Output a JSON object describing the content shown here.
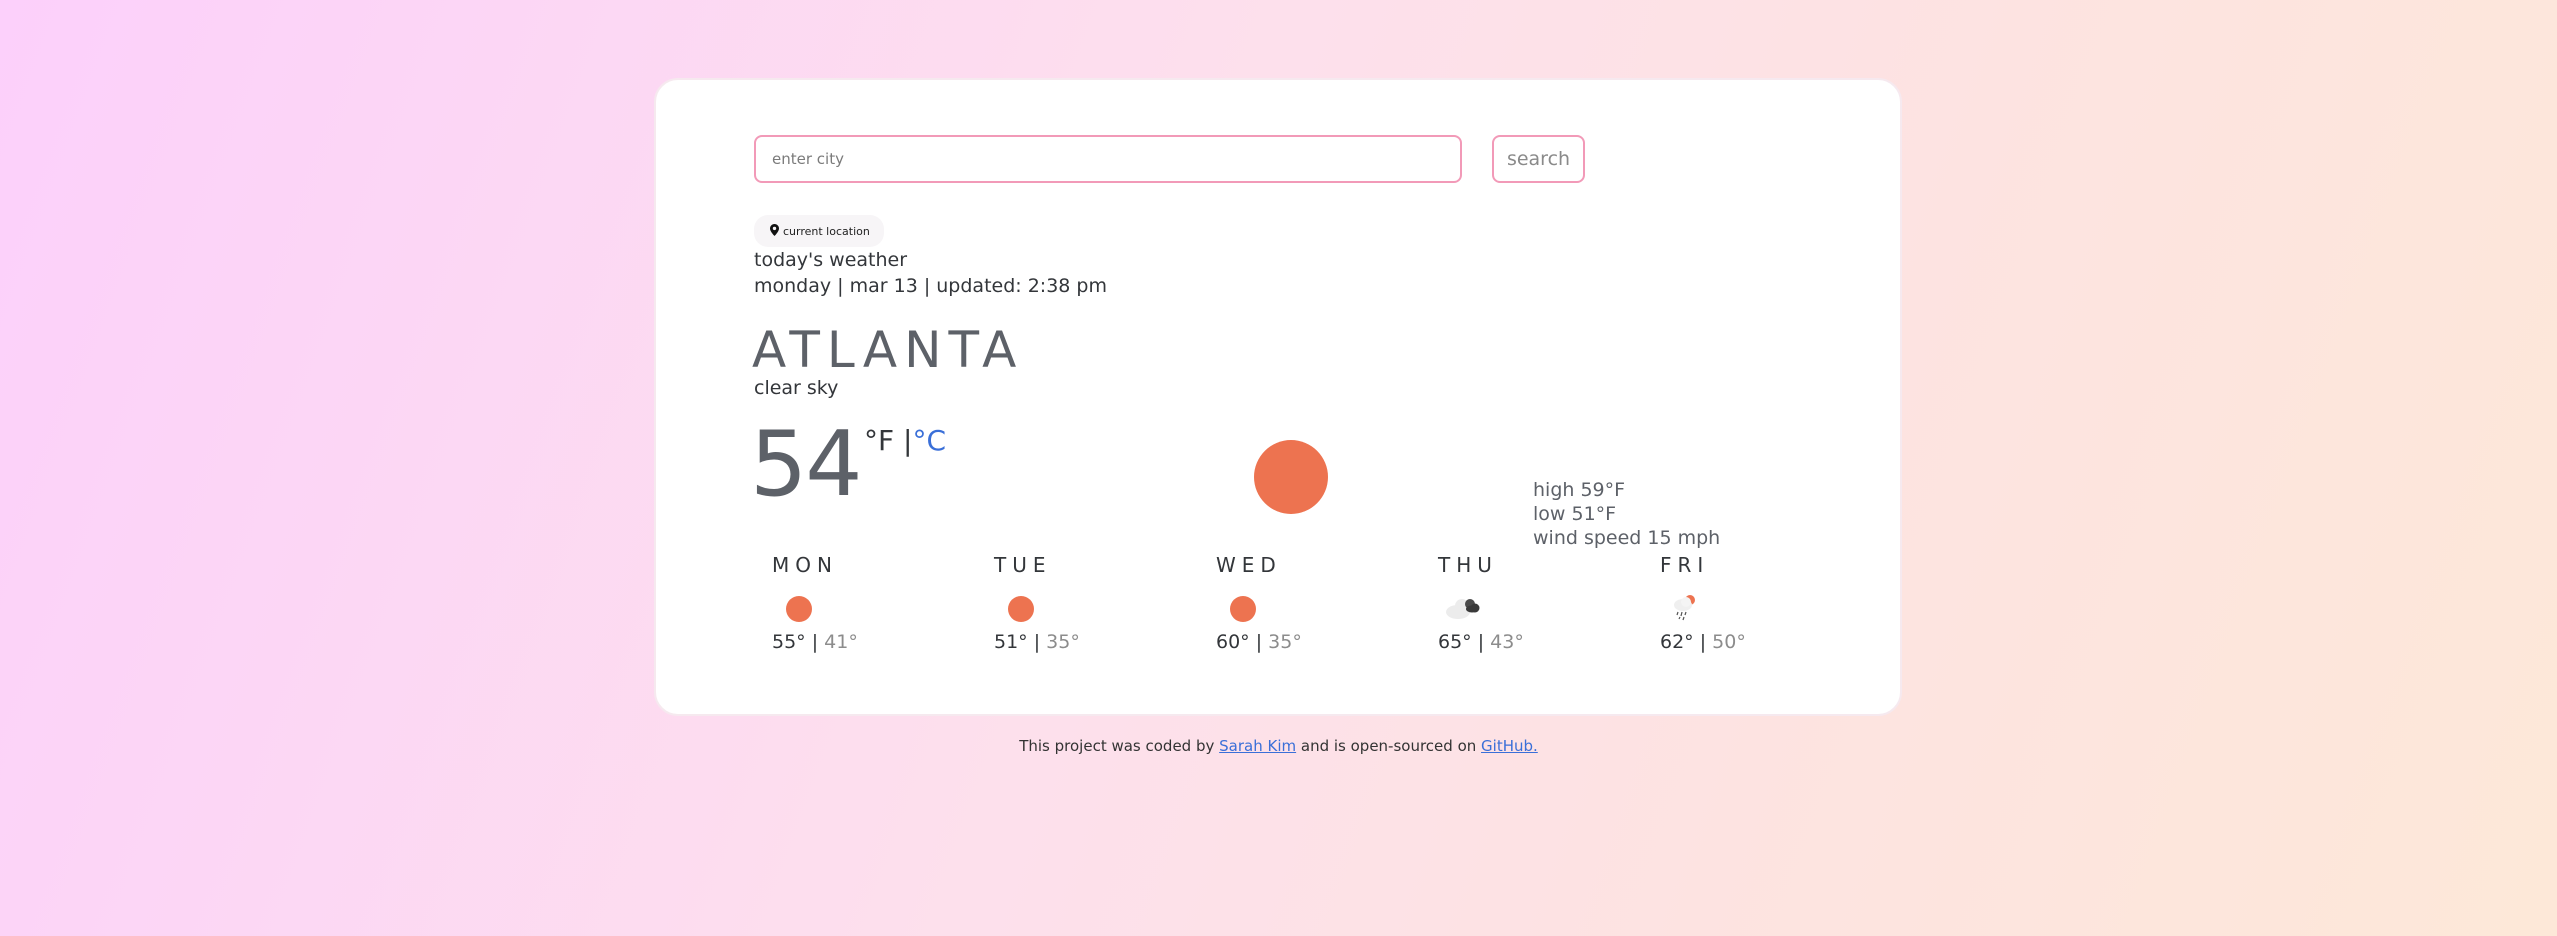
{
  "search": {
    "placeholder": "enter city",
    "value": "",
    "button_label": "search"
  },
  "location_button": {
    "label": "current location",
    "icon": "map-pin-icon"
  },
  "today": {
    "heading": "today's weather",
    "datetime": "monday | mar 13 | updated: 2:38 pm",
    "city": "ATLANTA",
    "description": "clear sky",
    "temperature": "54",
    "unit_f": "°F",
    "unit_sep": " |",
    "unit_c": "°C",
    "icon": "sun-icon",
    "high": "high 59°F",
    "low": "low 51°F",
    "wind": "wind speed 15 mph"
  },
  "forecast": [
    {
      "day": "MON",
      "icon": "sun-icon",
      "high": "55°",
      "low": "41°"
    },
    {
      "day": "TUE",
      "icon": "sun-icon",
      "high": "51°",
      "low": "35°"
    },
    {
      "day": "WED",
      "icon": "sun-icon",
      "high": "60°",
      "low": "35°"
    },
    {
      "day": "THU",
      "icon": "clouds-icon",
      "high": "65°",
      "low": "43°"
    },
    {
      "day": "FRI",
      "icon": "rain-sun-icon",
      "high": "62°",
      "low": "50°"
    }
  ],
  "footer": {
    "prefix": "This project was coded by ",
    "author": "Sarah Kim",
    "middle": " and is open-sourced on ",
    "github": "GitHub."
  },
  "colors": {
    "accent": "#ed7350",
    "link": "#3a6fd8",
    "border": "#f29ab8"
  }
}
